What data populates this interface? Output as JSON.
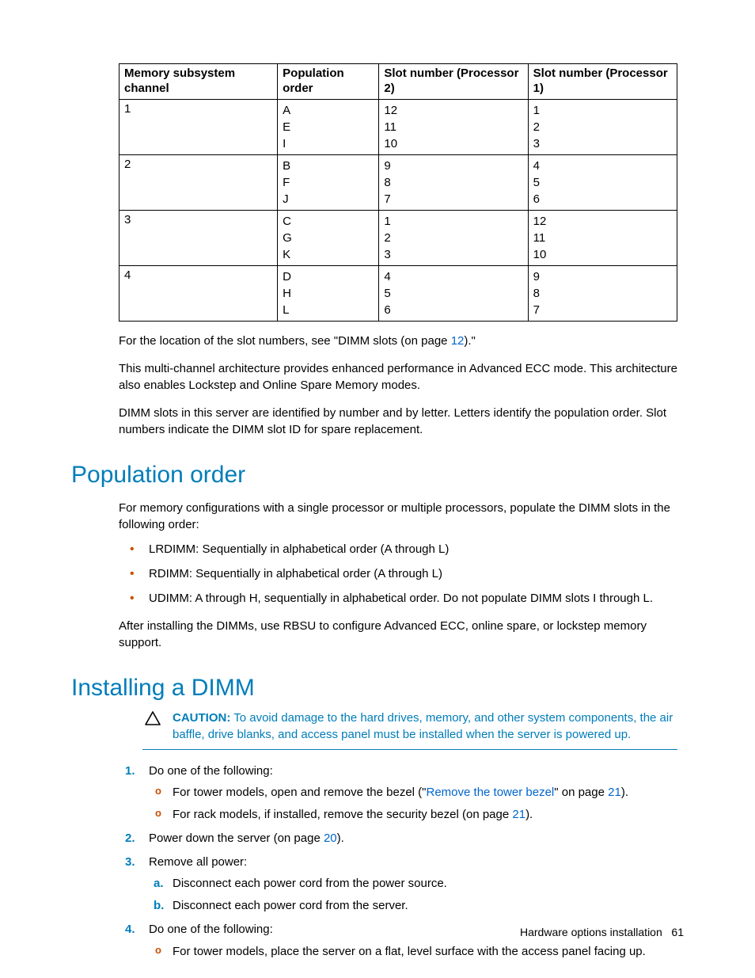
{
  "table": {
    "headers": [
      "Memory subsystem channel",
      "Population order",
      "Slot number (Processor 2)",
      "Slot number (Processor 1)"
    ],
    "rows": [
      {
        "channel": "1",
        "order": [
          "A",
          "E",
          "I"
        ],
        "proc2": [
          "12",
          "11",
          "10"
        ],
        "proc1": [
          "1",
          "2",
          "3"
        ]
      },
      {
        "channel": "2",
        "order": [
          "B",
          "F",
          "J"
        ],
        "proc2": [
          "9",
          "8",
          "7"
        ],
        "proc1": [
          "4",
          "5",
          "6"
        ]
      },
      {
        "channel": "3",
        "order": [
          "C",
          "G",
          "K"
        ],
        "proc2": [
          "1",
          "2",
          "3"
        ],
        "proc1": [
          "12",
          "11",
          "10"
        ]
      },
      {
        "channel": "4",
        "order": [
          "D",
          "H",
          "L"
        ],
        "proc2": [
          "4",
          "5",
          "6"
        ],
        "proc1": [
          "9",
          "8",
          "7"
        ]
      }
    ]
  },
  "para_slot_loc_pre": "For the location of the slot numbers, see \"DIMM slots (on page ",
  "para_slot_loc_link": "12",
  "para_slot_loc_post": ").\"",
  "para_arch": "This multi-channel architecture provides enhanced performance in Advanced ECC mode. This architecture also enables Lockstep and Online Spare Memory modes.",
  "para_ident": "DIMM slots in this server are identified by number and by letter. Letters identify the population order. Slot numbers indicate the DIMM slot ID for spare replacement.",
  "heading_pop": "Population order",
  "para_pop_intro": "For memory configurations with a single processor or multiple processors, populate the DIMM slots in the following order:",
  "bullets": [
    "LRDIMM: Sequentially in alphabetical order (A through L)",
    "RDIMM: Sequentially in alphabetical order (A through L)",
    "UDIMM: A through H, sequentially in alphabetical order. Do not populate DIMM slots I through L."
  ],
  "para_after_install": "After installing the DIMMs, use RBSU to configure Advanced ECC, online spare, or lockstep memory support.",
  "heading_install": "Installing a DIMM",
  "caution_label": "CAUTION:",
  "caution_text": "  To avoid damage to the hard drives, memory, and other system components, the air baffle, drive blanks, and access panel must be installed when the server is powered up.",
  "steps": {
    "s1": "Do one of the following:",
    "s1a_pre": "For tower models, open and remove the bezel (\"",
    "s1a_link": "Remove the tower bezel",
    "s1a_mid": "\" on page ",
    "s1a_page": "21",
    "s1a_post": ").",
    "s1b_pre": "For rack models, if installed, remove the security bezel (on page ",
    "s1b_page": "21",
    "s1b_post": ").",
    "s2_pre": "Power down the server (on page ",
    "s2_page": "20",
    "s2_post": ").",
    "s3": "Remove all power:",
    "s3a": "Disconnect each power cord from the power source.",
    "s3b": "Disconnect each power cord from the server.",
    "s4": "Do one of the following:",
    "s4a": "For tower models, place the server on a flat, level surface with the access panel facing up."
  },
  "footer_text": "Hardware options installation",
  "footer_page": "61"
}
